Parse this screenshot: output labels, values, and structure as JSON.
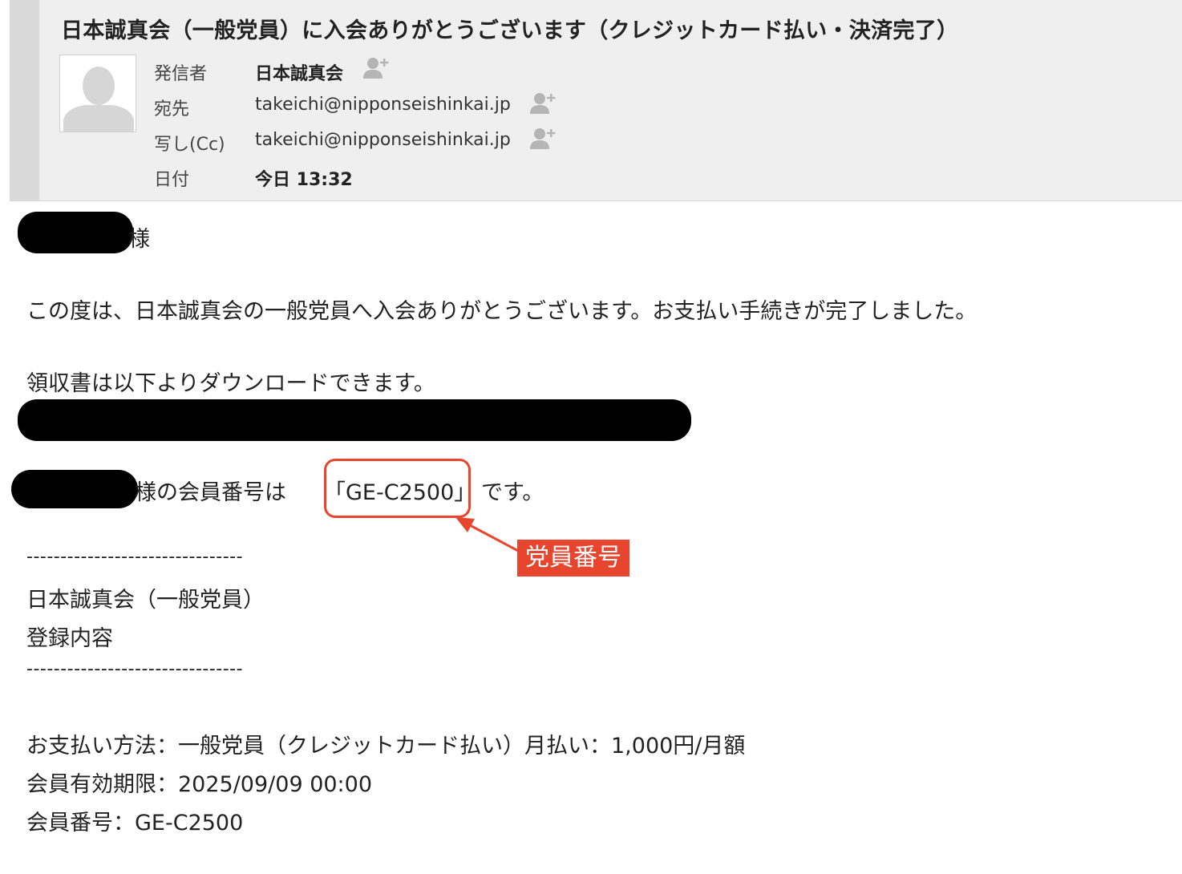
{
  "email": {
    "subject": "日本誠真会（一般党員）に入会ありがとうございます（クレジットカード払い・決済完了）",
    "from_label": "発信者",
    "from_value": "日本誠真会",
    "to_label": "宛先",
    "to_value": "takeichi@nipponseishinkai.jp",
    "cc_label": "写し(Cc)",
    "cc_value": "takeichi@nipponseishinkai.jp",
    "date_label": "日付",
    "date_value": "今日 13:32"
  },
  "body": {
    "salutation_suffix": "様",
    "line_thanks": "この度は、日本誠真会の一般党員へ入会ありがとうございます。お支払い手続きが完了しました。",
    "line_receipt": "領収書は以下よりダウンロードできます。",
    "member_line_prefix": "様の会員番号は",
    "member_number_quoted": "「GE-C2500」",
    "member_line_suffix": "です。",
    "divider": "--------------------------------",
    "reg_title": "日本誠真会（一般党員）",
    "reg_subtitle": "登録内容",
    "payment_method": "お支払い方法：一般党員（クレジットカード払い）月払い：1,000円/月額",
    "expiry": "会員有効期限：2025/09/09 00:00",
    "member_number": "会員番号：GE-C2500"
  },
  "annotation": {
    "label": "党員番号",
    "color": "#e8452f"
  },
  "icons": {
    "avatar": "person-silhouette-icon",
    "add_contact": "add-contact-icon"
  }
}
